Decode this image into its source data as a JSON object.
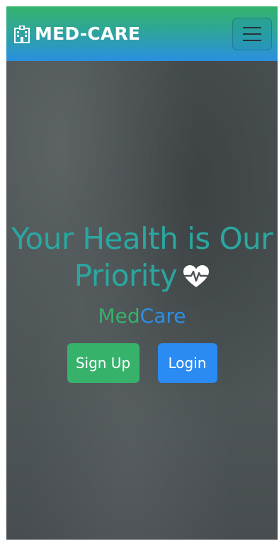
{
  "navbar": {
    "brand_icon": "hospital-icon",
    "brand_text": "MED-CARE",
    "menu_icon": "hamburger-menu-icon"
  },
  "hero": {
    "headline_line1": "Your Health is Our",
    "headline_line2": "Priority",
    "heart_icon": "heartbeat-icon",
    "brand_med": "Med",
    "brand_care": "Care",
    "signup_label": "Sign Up",
    "login_label": "Login"
  },
  "colors": {
    "nav_gradient_top": "#33b36b",
    "nav_gradient_bottom": "#2a8fe0",
    "headline": "#2aa7a1",
    "med_green": "#34b36a",
    "care_blue": "#2b8fe6",
    "signup_bg": "#37b26b",
    "login_bg": "#2a8bf2",
    "hero_bg": "#4a5153"
  }
}
